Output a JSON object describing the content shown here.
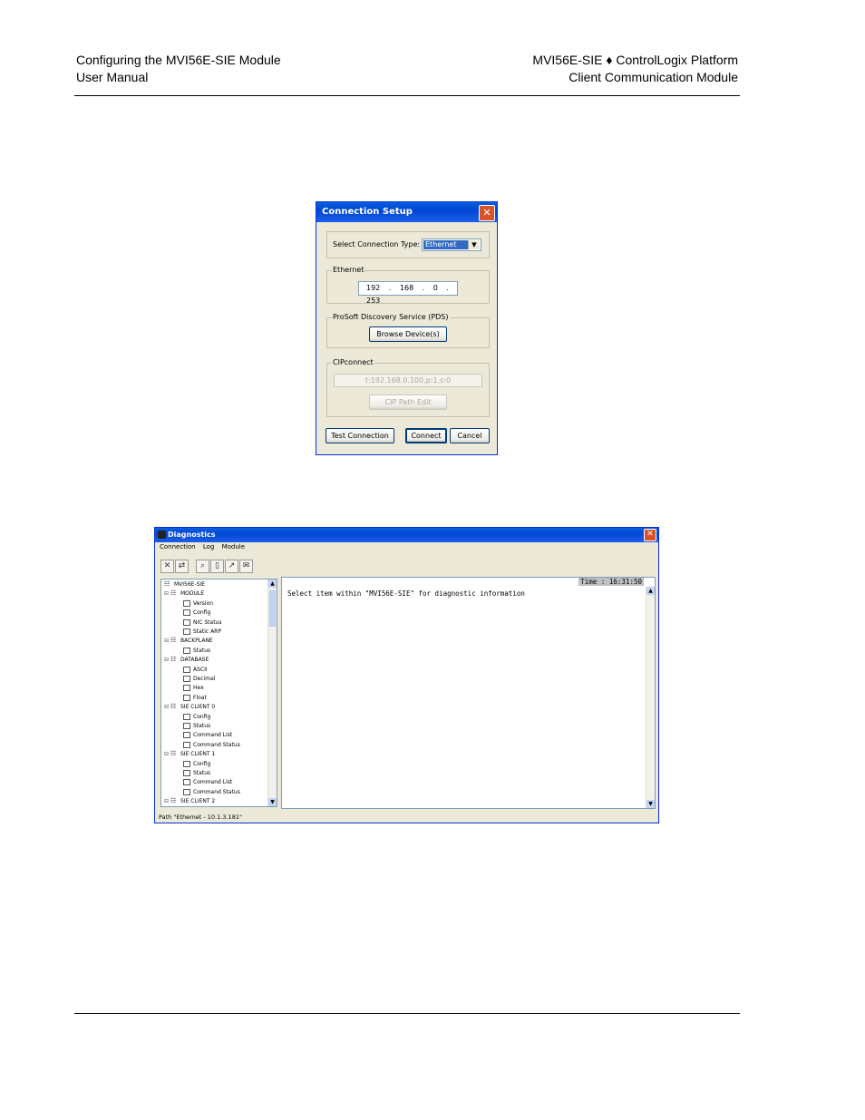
{
  "header": {
    "left_line1": "Configuring the MVI56E-SIE Module",
    "left_line2": "User Manual",
    "right_line1": "MVI56E-SIE ♦ ControlLogix Platform",
    "right_line2": "Client Communication Module"
  },
  "connection_dialog": {
    "title": "Connection Setup",
    "close_glyph": "✕",
    "select_label": "Select Connection Type:",
    "select_value": "Ethernet",
    "select_arrow": "▼",
    "ethernet_label": "Ethernet",
    "ip_address": "192 . 168 . 0 . 253",
    "pds_label": "ProSoft Discovery Service (PDS)",
    "browse_button": "Browse Device(s)",
    "cip_label": "CIPconnect",
    "cip_path": "t:192.168.0.100,p:1,s:0",
    "cip_edit_button": "CIP Path Edit",
    "test_button": "Test Connection",
    "connect_button": "Connect",
    "cancel_button": "Cancel"
  },
  "diagnostics": {
    "title": "Diagnostics",
    "close_glyph": "✕",
    "menu": [
      "Connection",
      "Log",
      "Module"
    ],
    "toolbar_icons": [
      "disconnect-icon",
      "connect-icon",
      "search-icon",
      "page-icon",
      "export-icon",
      "mail-icon"
    ],
    "tree": [
      {
        "label": "MVI56E-SIE",
        "level": 0,
        "icon": "module-icon",
        "expander": ""
      },
      {
        "label": "MODULE",
        "level": 1,
        "icon": "network-icon",
        "expander": "⊟"
      },
      {
        "label": "Version",
        "level": 2,
        "icon": "page-icon",
        "expander": ""
      },
      {
        "label": "Config",
        "level": 2,
        "icon": "page-icon",
        "expander": ""
      },
      {
        "label": "NIC Status",
        "level": 2,
        "icon": "page-icon",
        "expander": ""
      },
      {
        "label": "Static ARP",
        "level": 2,
        "icon": "page-icon",
        "expander": ""
      },
      {
        "label": "BACKPLANE",
        "level": 1,
        "icon": "network-icon",
        "expander": "⊟"
      },
      {
        "label": "Status",
        "level": 2,
        "icon": "page-icon",
        "expander": ""
      },
      {
        "label": "DATABASE",
        "level": 1,
        "icon": "network-icon",
        "expander": "⊟"
      },
      {
        "label": "ASCII",
        "level": 2,
        "icon": "page-icon",
        "expander": ""
      },
      {
        "label": "Decimal",
        "level": 2,
        "icon": "page-icon",
        "expander": ""
      },
      {
        "label": "Hex",
        "level": 2,
        "icon": "page-icon",
        "expander": ""
      },
      {
        "label": "Float",
        "level": 2,
        "icon": "page-icon",
        "expander": ""
      },
      {
        "label": "SIE CLIENT 0",
        "level": 1,
        "icon": "network-icon",
        "expander": "⊟"
      },
      {
        "label": "Config",
        "level": 2,
        "icon": "page-icon",
        "expander": ""
      },
      {
        "label": "Status",
        "level": 2,
        "icon": "page-icon",
        "expander": ""
      },
      {
        "label": "Command List",
        "level": 2,
        "icon": "page-icon",
        "expander": ""
      },
      {
        "label": "Command Status",
        "level": 2,
        "icon": "page-icon",
        "expander": ""
      },
      {
        "label": "SIE CLIENT 1",
        "level": 1,
        "icon": "network-icon",
        "expander": "⊟"
      },
      {
        "label": "Config",
        "level": 2,
        "icon": "page-icon",
        "expander": ""
      },
      {
        "label": "Status",
        "level": 2,
        "icon": "page-icon",
        "expander": ""
      },
      {
        "label": "Command List",
        "level": 2,
        "icon": "page-icon",
        "expander": ""
      },
      {
        "label": "Command Status",
        "level": 2,
        "icon": "page-icon",
        "expander": ""
      },
      {
        "label": "SIE CLIENT 2",
        "level": 1,
        "icon": "network-icon",
        "expander": "⊟"
      }
    ],
    "time": "Time : 16:31:50",
    "message": "Select item within \"MVI56E-SIE\" for diagnostic information",
    "status_path": "Path \"Ethernet - 10.1.3.181\""
  }
}
